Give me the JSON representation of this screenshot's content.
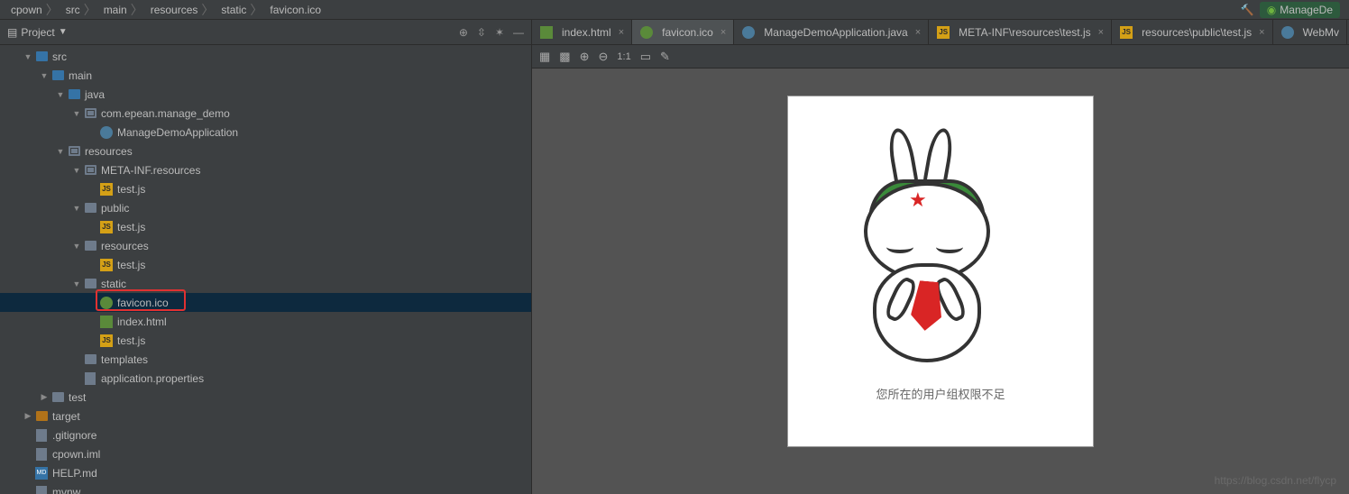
{
  "breadcrumb": [
    "cpown",
    "src",
    "main",
    "resources",
    "static",
    "favicon.ico"
  ],
  "topRight": {
    "hammer": "build-icon",
    "run": "ManageDe"
  },
  "panel": {
    "title": "Project"
  },
  "tree": [
    {
      "d": 1,
      "exp": "open",
      "ico": "dir",
      "cls": "blue",
      "lbl": "src"
    },
    {
      "d": 2,
      "exp": "open",
      "ico": "dir",
      "cls": "blue",
      "lbl": "main"
    },
    {
      "d": 3,
      "exp": "open",
      "ico": "dir",
      "cls": "blue",
      "lbl": "java"
    },
    {
      "d": 4,
      "exp": "open",
      "ico": "pkg",
      "lbl": "com.epean.manage_demo"
    },
    {
      "d": 5,
      "exp": "none",
      "ico": "class",
      "lbl": "ManageDemoApplication"
    },
    {
      "d": 3,
      "exp": "open",
      "ico": "pkg",
      "lbl": "resources"
    },
    {
      "d": 4,
      "exp": "open",
      "ico": "pkg",
      "lbl": "META-INF.resources"
    },
    {
      "d": 5,
      "exp": "none",
      "ico": "js",
      "lbl": "test.js"
    },
    {
      "d": 4,
      "exp": "open",
      "ico": "dir",
      "lbl": "public"
    },
    {
      "d": 5,
      "exp": "none",
      "ico": "js",
      "lbl": "test.js"
    },
    {
      "d": 4,
      "exp": "open",
      "ico": "dir",
      "lbl": "resources"
    },
    {
      "d": 5,
      "exp": "none",
      "ico": "js",
      "lbl": "test.js"
    },
    {
      "d": 4,
      "exp": "open",
      "ico": "dir",
      "lbl": "static"
    },
    {
      "d": 5,
      "exp": "none",
      "ico": "ico",
      "lbl": "favicon.ico",
      "sel": true,
      "hl": true
    },
    {
      "d": 5,
      "exp": "none",
      "ico": "html",
      "lbl": "index.html"
    },
    {
      "d": 5,
      "exp": "none",
      "ico": "js",
      "lbl": "test.js"
    },
    {
      "d": 4,
      "exp": "none",
      "ico": "dir",
      "lbl": "templates"
    },
    {
      "d": 4,
      "exp": "none",
      "ico": "file",
      "lbl": "application.properties"
    },
    {
      "d": 2,
      "exp": "closed",
      "ico": "dir",
      "lbl": "test"
    },
    {
      "d": 1,
      "exp": "closed",
      "ico": "dir",
      "cls": "orange",
      "lbl": "target"
    },
    {
      "d": 1,
      "exp": "none",
      "ico": "file",
      "lbl": ".gitignore"
    },
    {
      "d": 1,
      "exp": "none",
      "ico": "file",
      "lbl": "cpown.iml"
    },
    {
      "d": 1,
      "exp": "none",
      "ico": "md",
      "lbl": "HELP.md"
    },
    {
      "d": 1,
      "exp": "none",
      "ico": "file",
      "lbl": "mvnw"
    }
  ],
  "tabs": [
    {
      "ico": "html",
      "lbl": "index.html",
      "active": false
    },
    {
      "ico": "ico",
      "lbl": "favicon.ico",
      "active": true
    },
    {
      "ico": "class",
      "lbl": "ManageDemoApplication.java",
      "active": false
    },
    {
      "ico": "js",
      "lbl": "META-INF\\resources\\test.js",
      "active": false
    },
    {
      "ico": "js",
      "lbl": "resources\\public\\test.js",
      "active": false
    },
    {
      "ico": "class",
      "lbl": "WebMv",
      "noclose": true
    }
  ],
  "imgbar": {
    "ratio": "1:1"
  },
  "caption": "您所在的用户组权限不足",
  "watermark": "https://blog.csdn.net/flycp"
}
